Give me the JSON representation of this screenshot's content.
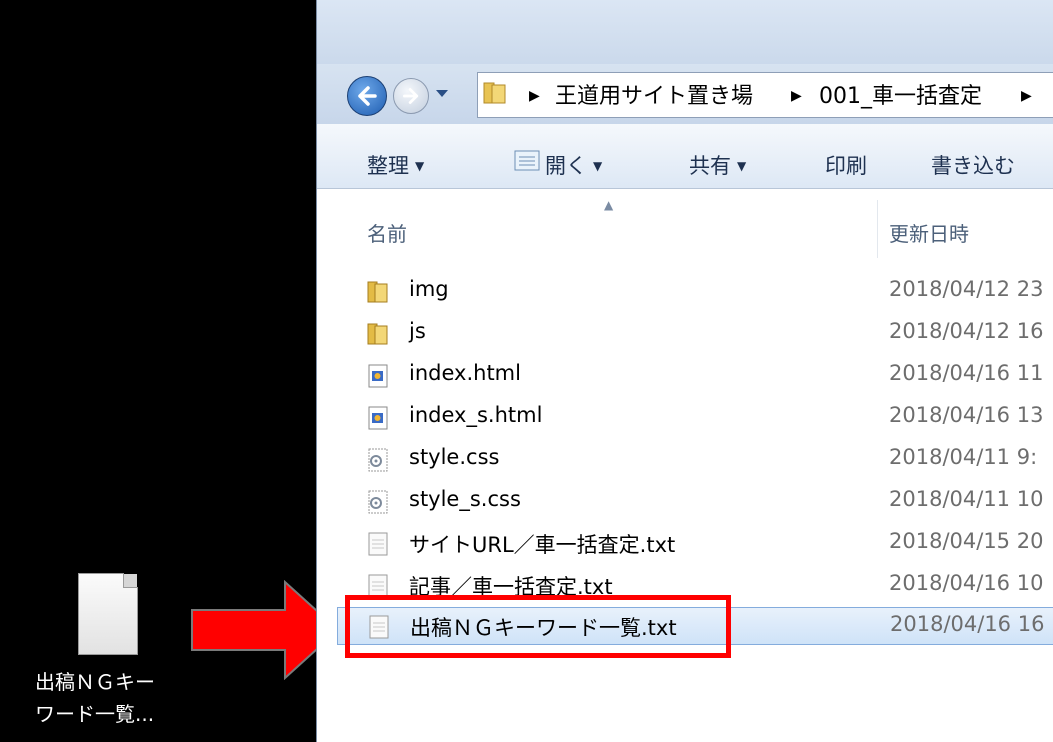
{
  "address_bar": {
    "crumbs": [
      "王道用サイト置き場",
      "001_車一括査定"
    ]
  },
  "toolbar": {
    "organize": "整理",
    "open": "開く",
    "share": "共有",
    "print": "印刷",
    "burn": "書き込む"
  },
  "columns": {
    "name": "名前",
    "date": "更新日時"
  },
  "files": [
    {
      "name": "img",
      "date": "2018/04/12 23",
      "icon": "folder-icon"
    },
    {
      "name": "js",
      "date": "2018/04/12 16",
      "icon": "folder-icon"
    },
    {
      "name": "index.html",
      "date": "2018/04/16 11",
      "icon": "html-file-icon"
    },
    {
      "name": "index_s.html",
      "date": "2018/04/16 13",
      "icon": "html-file-icon"
    },
    {
      "name": "style.css",
      "date": "2018/04/11 9:",
      "icon": "css-file-icon"
    },
    {
      "name": "style_s.css",
      "date": "2018/04/11 10",
      "icon": "css-file-icon"
    },
    {
      "name": "サイトURL／車一括査定.txt",
      "date": "2018/04/15 20",
      "icon": "text-file-icon"
    },
    {
      "name": "記事／車一括査定.txt",
      "date": "2018/04/16 10",
      "icon": "text-file-icon"
    },
    {
      "name": "出稿ＮＧキーワード一覧.txt",
      "date": "2018/04/16 16",
      "icon": "text-file-icon",
      "selected": true
    }
  ],
  "desktop_icon": {
    "label_line1": "出稿ＮＧキー",
    "label_line2": "ワード一覧..."
  },
  "colors": {
    "highlight": "#ff0000",
    "selection": "#cfe3f8"
  }
}
